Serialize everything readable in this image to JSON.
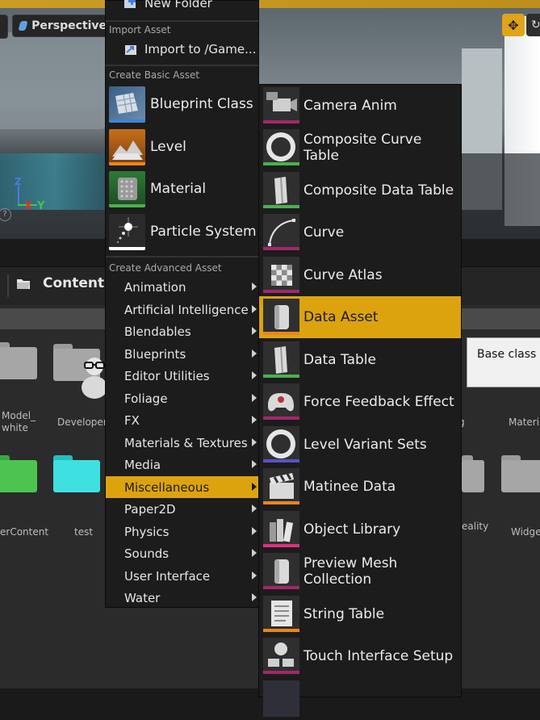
{
  "viewport": {
    "perspective_label": "Perspective",
    "axis_z": "Z",
    "axis_x": "X",
    "axis_y": "Y",
    "help_glyph": "?"
  },
  "content_browser": {
    "title": "Content",
    "folders": [
      {
        "label": "Model_\nwhite"
      },
      {
        "label": "Developers"
      },
      {
        "label": "Materia"
      },
      {
        "label": "erContent"
      },
      {
        "label": "test"
      },
      {
        "label": "eality"
      },
      {
        "label": "Widge"
      },
      {
        "label": "g"
      }
    ]
  },
  "tooltip": {
    "text": "Base class f"
  },
  "menu": {
    "new_folder": "New Folder",
    "import_header": "Import Asset",
    "import_item": "Import to /Game...",
    "basic_header": "Create Basic Asset",
    "basic_items": [
      {
        "label": "Blueprint Class",
        "icon": "blueprint-class-icon",
        "bar": "#3c86d6"
      },
      {
        "label": "Level",
        "icon": "level-icon",
        "bar": "#e8871e"
      },
      {
        "label": "Material",
        "icon": "material-icon",
        "bar": "#4caf50"
      },
      {
        "label": "Particle System",
        "icon": "particle-system-icon",
        "bar": "#ffffff"
      }
    ],
    "advanced_header": "Create Advanced Asset",
    "advanced_items": [
      {
        "label": "Animation"
      },
      {
        "label": "Artificial Intelligence"
      },
      {
        "label": "Blendables"
      },
      {
        "label": "Blueprints"
      },
      {
        "label": "Editor Utilities"
      },
      {
        "label": "Foliage"
      },
      {
        "label": "FX"
      },
      {
        "label": "Materials & Textures"
      },
      {
        "label": "Media"
      },
      {
        "label": "Miscellaneous"
      },
      {
        "label": "Paper2D"
      },
      {
        "label": "Physics"
      },
      {
        "label": "Sounds"
      },
      {
        "label": "User Interface"
      },
      {
        "label": "Water"
      }
    ],
    "selected_category": "Miscellaneous"
  },
  "submenu": {
    "items": [
      {
        "label": "Camera Anim",
        "icon": "camera-anim-icon",
        "bar": "#a1286a"
      },
      {
        "label": "Composite Curve Table",
        "icon": "composite-curve-table-icon",
        "bar": "#4caf50"
      },
      {
        "label": "Composite Data Table",
        "icon": "composite-data-table-icon",
        "bar": "#4caf50"
      },
      {
        "label": "Curve",
        "icon": "curve-icon",
        "bar": "#a1286a"
      },
      {
        "label": "Curve Atlas",
        "icon": "curve-atlas-icon",
        "bar": "#a1286a"
      },
      {
        "label": "Data Asset",
        "icon": "data-asset-icon",
        "bar": "#e8871e"
      },
      {
        "label": "Data Table",
        "icon": "data-table-icon",
        "bar": "#4caf50"
      },
      {
        "label": "Force Feedback Effect",
        "icon": "force-feedback-icon",
        "bar": "#a1286a"
      },
      {
        "label": "Level Variant Sets",
        "icon": "level-variant-sets-icon",
        "bar": "#5a4fc8"
      },
      {
        "label": "Matinee Data",
        "icon": "matinee-data-icon",
        "bar": "#e8871e"
      },
      {
        "label": "Object Library",
        "icon": "object-library-icon",
        "bar": "#e0307a"
      },
      {
        "label": "Preview Mesh Collection",
        "icon": "preview-mesh-collection-icon",
        "bar": "#a1286a"
      },
      {
        "label": "String Table",
        "icon": "string-table-icon",
        "bar": "#e8871e"
      },
      {
        "label": "Touch Interface Setup",
        "icon": "touch-interface-setup-icon",
        "bar": "#a1286a"
      }
    ],
    "selected": "Data Asset"
  }
}
